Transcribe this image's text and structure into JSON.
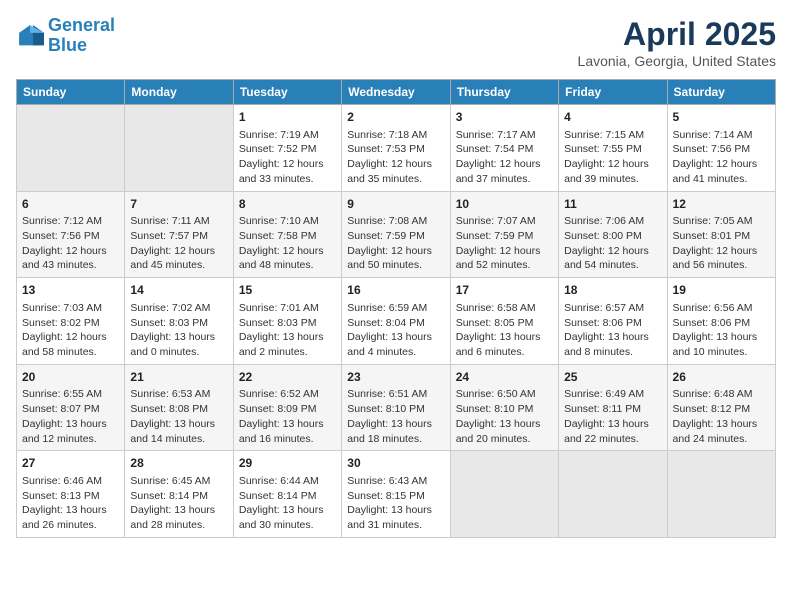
{
  "logo": {
    "line1": "General",
    "line2": "Blue"
  },
  "title": "April 2025",
  "subtitle": "Lavonia, Georgia, United States",
  "days_of_week": [
    "Sunday",
    "Monday",
    "Tuesday",
    "Wednesday",
    "Thursday",
    "Friday",
    "Saturday"
  ],
  "weeks": [
    [
      {
        "day": "",
        "sunrise": "",
        "sunset": "",
        "daylight": "",
        "empty": true
      },
      {
        "day": "",
        "sunrise": "",
        "sunset": "",
        "daylight": "",
        "empty": true
      },
      {
        "day": "1",
        "sunrise": "Sunrise: 7:19 AM",
        "sunset": "Sunset: 7:52 PM",
        "daylight": "Daylight: 12 hours and 33 minutes."
      },
      {
        "day": "2",
        "sunrise": "Sunrise: 7:18 AM",
        "sunset": "Sunset: 7:53 PM",
        "daylight": "Daylight: 12 hours and 35 minutes."
      },
      {
        "day": "3",
        "sunrise": "Sunrise: 7:17 AM",
        "sunset": "Sunset: 7:54 PM",
        "daylight": "Daylight: 12 hours and 37 minutes."
      },
      {
        "day": "4",
        "sunrise": "Sunrise: 7:15 AM",
        "sunset": "Sunset: 7:55 PM",
        "daylight": "Daylight: 12 hours and 39 minutes."
      },
      {
        "day": "5",
        "sunrise": "Sunrise: 7:14 AM",
        "sunset": "Sunset: 7:56 PM",
        "daylight": "Daylight: 12 hours and 41 minutes."
      }
    ],
    [
      {
        "day": "6",
        "sunrise": "Sunrise: 7:12 AM",
        "sunset": "Sunset: 7:56 PM",
        "daylight": "Daylight: 12 hours and 43 minutes."
      },
      {
        "day": "7",
        "sunrise": "Sunrise: 7:11 AM",
        "sunset": "Sunset: 7:57 PM",
        "daylight": "Daylight: 12 hours and 45 minutes."
      },
      {
        "day": "8",
        "sunrise": "Sunrise: 7:10 AM",
        "sunset": "Sunset: 7:58 PM",
        "daylight": "Daylight: 12 hours and 48 minutes."
      },
      {
        "day": "9",
        "sunrise": "Sunrise: 7:08 AM",
        "sunset": "Sunset: 7:59 PM",
        "daylight": "Daylight: 12 hours and 50 minutes."
      },
      {
        "day": "10",
        "sunrise": "Sunrise: 7:07 AM",
        "sunset": "Sunset: 7:59 PM",
        "daylight": "Daylight: 12 hours and 52 minutes."
      },
      {
        "day": "11",
        "sunrise": "Sunrise: 7:06 AM",
        "sunset": "Sunset: 8:00 PM",
        "daylight": "Daylight: 12 hours and 54 minutes."
      },
      {
        "day": "12",
        "sunrise": "Sunrise: 7:05 AM",
        "sunset": "Sunset: 8:01 PM",
        "daylight": "Daylight: 12 hours and 56 minutes."
      }
    ],
    [
      {
        "day": "13",
        "sunrise": "Sunrise: 7:03 AM",
        "sunset": "Sunset: 8:02 PM",
        "daylight": "Daylight: 12 hours and 58 minutes."
      },
      {
        "day": "14",
        "sunrise": "Sunrise: 7:02 AM",
        "sunset": "Sunset: 8:03 PM",
        "daylight": "Daylight: 13 hours and 0 minutes."
      },
      {
        "day": "15",
        "sunrise": "Sunrise: 7:01 AM",
        "sunset": "Sunset: 8:03 PM",
        "daylight": "Daylight: 13 hours and 2 minutes."
      },
      {
        "day": "16",
        "sunrise": "Sunrise: 6:59 AM",
        "sunset": "Sunset: 8:04 PM",
        "daylight": "Daylight: 13 hours and 4 minutes."
      },
      {
        "day": "17",
        "sunrise": "Sunrise: 6:58 AM",
        "sunset": "Sunset: 8:05 PM",
        "daylight": "Daylight: 13 hours and 6 minutes."
      },
      {
        "day": "18",
        "sunrise": "Sunrise: 6:57 AM",
        "sunset": "Sunset: 8:06 PM",
        "daylight": "Daylight: 13 hours and 8 minutes."
      },
      {
        "day": "19",
        "sunrise": "Sunrise: 6:56 AM",
        "sunset": "Sunset: 8:06 PM",
        "daylight": "Daylight: 13 hours and 10 minutes."
      }
    ],
    [
      {
        "day": "20",
        "sunrise": "Sunrise: 6:55 AM",
        "sunset": "Sunset: 8:07 PM",
        "daylight": "Daylight: 13 hours and 12 minutes."
      },
      {
        "day": "21",
        "sunrise": "Sunrise: 6:53 AM",
        "sunset": "Sunset: 8:08 PM",
        "daylight": "Daylight: 13 hours and 14 minutes."
      },
      {
        "day": "22",
        "sunrise": "Sunrise: 6:52 AM",
        "sunset": "Sunset: 8:09 PM",
        "daylight": "Daylight: 13 hours and 16 minutes."
      },
      {
        "day": "23",
        "sunrise": "Sunrise: 6:51 AM",
        "sunset": "Sunset: 8:10 PM",
        "daylight": "Daylight: 13 hours and 18 minutes."
      },
      {
        "day": "24",
        "sunrise": "Sunrise: 6:50 AM",
        "sunset": "Sunset: 8:10 PM",
        "daylight": "Daylight: 13 hours and 20 minutes."
      },
      {
        "day": "25",
        "sunrise": "Sunrise: 6:49 AM",
        "sunset": "Sunset: 8:11 PM",
        "daylight": "Daylight: 13 hours and 22 minutes."
      },
      {
        "day": "26",
        "sunrise": "Sunrise: 6:48 AM",
        "sunset": "Sunset: 8:12 PM",
        "daylight": "Daylight: 13 hours and 24 minutes."
      }
    ],
    [
      {
        "day": "27",
        "sunrise": "Sunrise: 6:46 AM",
        "sunset": "Sunset: 8:13 PM",
        "daylight": "Daylight: 13 hours and 26 minutes."
      },
      {
        "day": "28",
        "sunrise": "Sunrise: 6:45 AM",
        "sunset": "Sunset: 8:14 PM",
        "daylight": "Daylight: 13 hours and 28 minutes."
      },
      {
        "day": "29",
        "sunrise": "Sunrise: 6:44 AM",
        "sunset": "Sunset: 8:14 PM",
        "daylight": "Daylight: 13 hours and 30 minutes."
      },
      {
        "day": "30",
        "sunrise": "Sunrise: 6:43 AM",
        "sunset": "Sunset: 8:15 PM",
        "daylight": "Daylight: 13 hours and 31 minutes."
      },
      {
        "day": "",
        "sunrise": "",
        "sunset": "",
        "daylight": "",
        "empty": true
      },
      {
        "day": "",
        "sunrise": "",
        "sunset": "",
        "daylight": "",
        "empty": true
      },
      {
        "day": "",
        "sunrise": "",
        "sunset": "",
        "daylight": "",
        "empty": true
      }
    ]
  ]
}
